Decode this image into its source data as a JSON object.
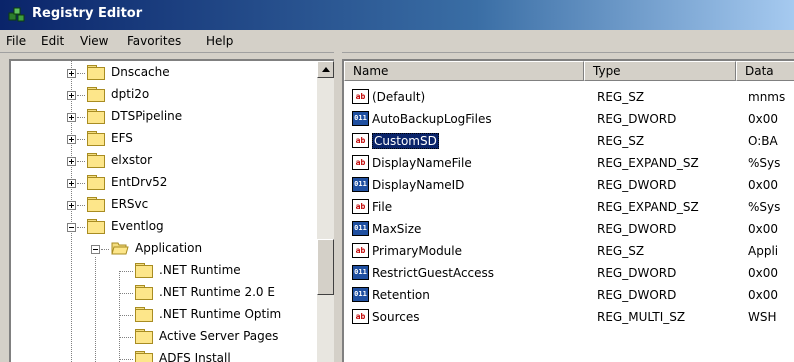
{
  "window": {
    "title": "Registry Editor"
  },
  "menu": [
    "File",
    "Edit",
    "View",
    "Favorites",
    "Help"
  ],
  "tree": [
    {
      "label": "Dnscache"
    },
    {
      "label": "dpti2o"
    },
    {
      "label": "DTSPipeline"
    },
    {
      "label": "EFS"
    },
    {
      "label": "elxstor"
    },
    {
      "label": "EntDrv52"
    },
    {
      "label": "ERSvc"
    },
    {
      "label": "Eventlog"
    },
    {
      "label": "Application"
    },
    {
      "label": ".NET Runtime"
    },
    {
      "label": ".NET Runtime 2.0 E"
    },
    {
      "label": ".NET Runtime Optim"
    },
    {
      "label": "Active Server Pages"
    },
    {
      "label": "ADFS Install"
    }
  ],
  "columns": {
    "name": "Name",
    "type": "Type",
    "data": "Data"
  },
  "values": [
    {
      "name": "(Default)",
      "type": "REG_SZ",
      "data": "mnms",
      "icon": "ab"
    },
    {
      "name": "AutoBackupLogFiles",
      "type": "REG_DWORD",
      "data": "0x00",
      "icon": "bin"
    },
    {
      "name": "CustomSD",
      "type": "REG_SZ",
      "data": "O:BA",
      "icon": "ab"
    },
    {
      "name": "DisplayNameFile",
      "type": "REG_EXPAND_SZ",
      "data": "%Sys",
      "icon": "ab"
    },
    {
      "name": "DisplayNameID",
      "type": "REG_DWORD",
      "data": "0x00",
      "icon": "bin"
    },
    {
      "name": "File",
      "type": "REG_EXPAND_SZ",
      "data": "%Sys",
      "icon": "ab"
    },
    {
      "name": "MaxSize",
      "type": "REG_DWORD",
      "data": "0x00",
      "icon": "bin"
    },
    {
      "name": "PrimaryModule",
      "type": "REG_SZ",
      "data": "Appli",
      "icon": "ab"
    },
    {
      "name": "RestrictGuestAccess",
      "type": "REG_DWORD",
      "data": "0x00",
      "icon": "bin"
    },
    {
      "name": "Retention",
      "type": "REG_DWORD",
      "data": "0x00",
      "icon": "bin"
    },
    {
      "name": "Sources",
      "type": "REG_MULTI_SZ",
      "data": "WSH",
      "icon": "ab"
    }
  ],
  "selected_value": "CustomSD",
  "colors": {
    "title_start": "#0a246a",
    "selection": "#0a246a",
    "folder": "#fde68a"
  }
}
